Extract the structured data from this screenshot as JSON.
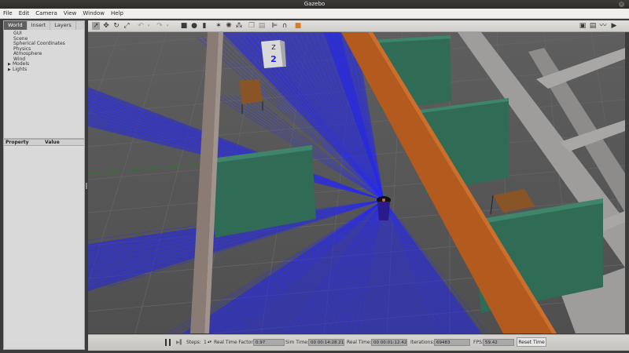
{
  "window": {
    "title": "Gazebo",
    "close_glyph": "×"
  },
  "menu": [
    "File",
    "Edit",
    "Camera",
    "View",
    "Window",
    "Help"
  ],
  "left_panel": {
    "tabs": [
      "World",
      "Insert",
      "Layers"
    ],
    "active_tab": "World",
    "tree": [
      {
        "label": "GUI",
        "expandable": false
      },
      {
        "label": "Scene",
        "expandable": false
      },
      {
        "label": "Spherical Coordinates",
        "expandable": false
      },
      {
        "label": "Physics",
        "expandable": false
      },
      {
        "label": "Atmosphere",
        "expandable": false
      },
      {
        "label": "Wind",
        "expandable": false
      },
      {
        "label": "Models",
        "expandable": true
      },
      {
        "label": "Lights",
        "expandable": true
      }
    ],
    "property_header": {
      "col1": "Property",
      "col2": "Value"
    }
  },
  "toolbar": {
    "tools": [
      "select-icon",
      "translate-icon",
      "rotate-icon",
      "scale-icon",
      "undo-icon",
      "undo-dropdown-icon",
      "redo-icon",
      "redo-dropdown-icon",
      "box-icon",
      "sphere-icon",
      "cylinder-icon",
      "point-light-icon",
      "spot-light-icon",
      "directional-light-icon",
      "copy-icon",
      "paste-icon",
      "align-icon",
      "snap-icon",
      "change-view-icon"
    ],
    "right_tools": [
      "screenshot-icon",
      "log-icon",
      "plot-icon",
      "video-icon"
    ]
  },
  "viewport": {
    "sign_text": "Z",
    "sign_number": "2",
    "colors": {
      "floor": "#5a5a5a",
      "laser": "#1f22f0",
      "partition": "#2f6b55",
      "wall": "#b35a1f",
      "frame": "#9d9a97"
    }
  },
  "bottom_bar": {
    "steps_label": "Steps:",
    "steps_value": "1",
    "rtf_label": "Real Time Factor:",
    "rtf_value": "0.97",
    "sim_time_label": "Sim Time:",
    "sim_time_value": "00 00:14:28.211",
    "real_time_label": "Real Time:",
    "real_time_value": "00 00:01:12.421",
    "iterations_label": "Iterations:",
    "iterations_value": "69483",
    "fps_label": "FPS:",
    "fps_value": "59.42",
    "reset_label": "Reset Time"
  }
}
